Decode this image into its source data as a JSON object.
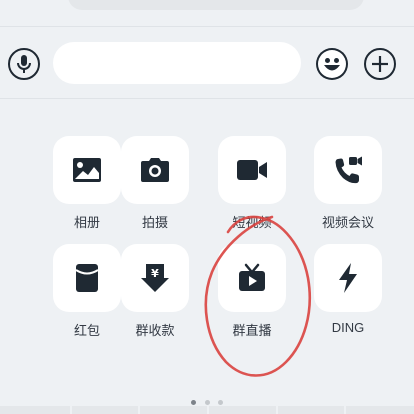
{
  "input_bar": {
    "text_value": "",
    "voice_icon": "microphone-icon",
    "emoji_icon": "smiley-icon",
    "more_icon": "plus-icon"
  },
  "actions": [
    {
      "label": "相册",
      "icon": "image-icon"
    },
    {
      "label": "拍摄",
      "icon": "camera-icon"
    },
    {
      "label": "短视频",
      "icon": "video-camera-icon"
    },
    {
      "label": "视频会议",
      "icon": "video-call-icon"
    },
    {
      "label": "红包",
      "icon": "red-packet-icon"
    },
    {
      "label": "群收款",
      "icon": "yuan-collect-icon"
    },
    {
      "label": "群直播",
      "icon": "live-tv-icon"
    },
    {
      "label": "DING",
      "icon": "lightning-icon"
    }
  ],
  "pager": {
    "pages": 3,
    "current": 1
  },
  "colors": {
    "icon": "#1f2933",
    "tile": "#ffffff",
    "background": "#eef1f4",
    "annotation": "#d9423f"
  }
}
